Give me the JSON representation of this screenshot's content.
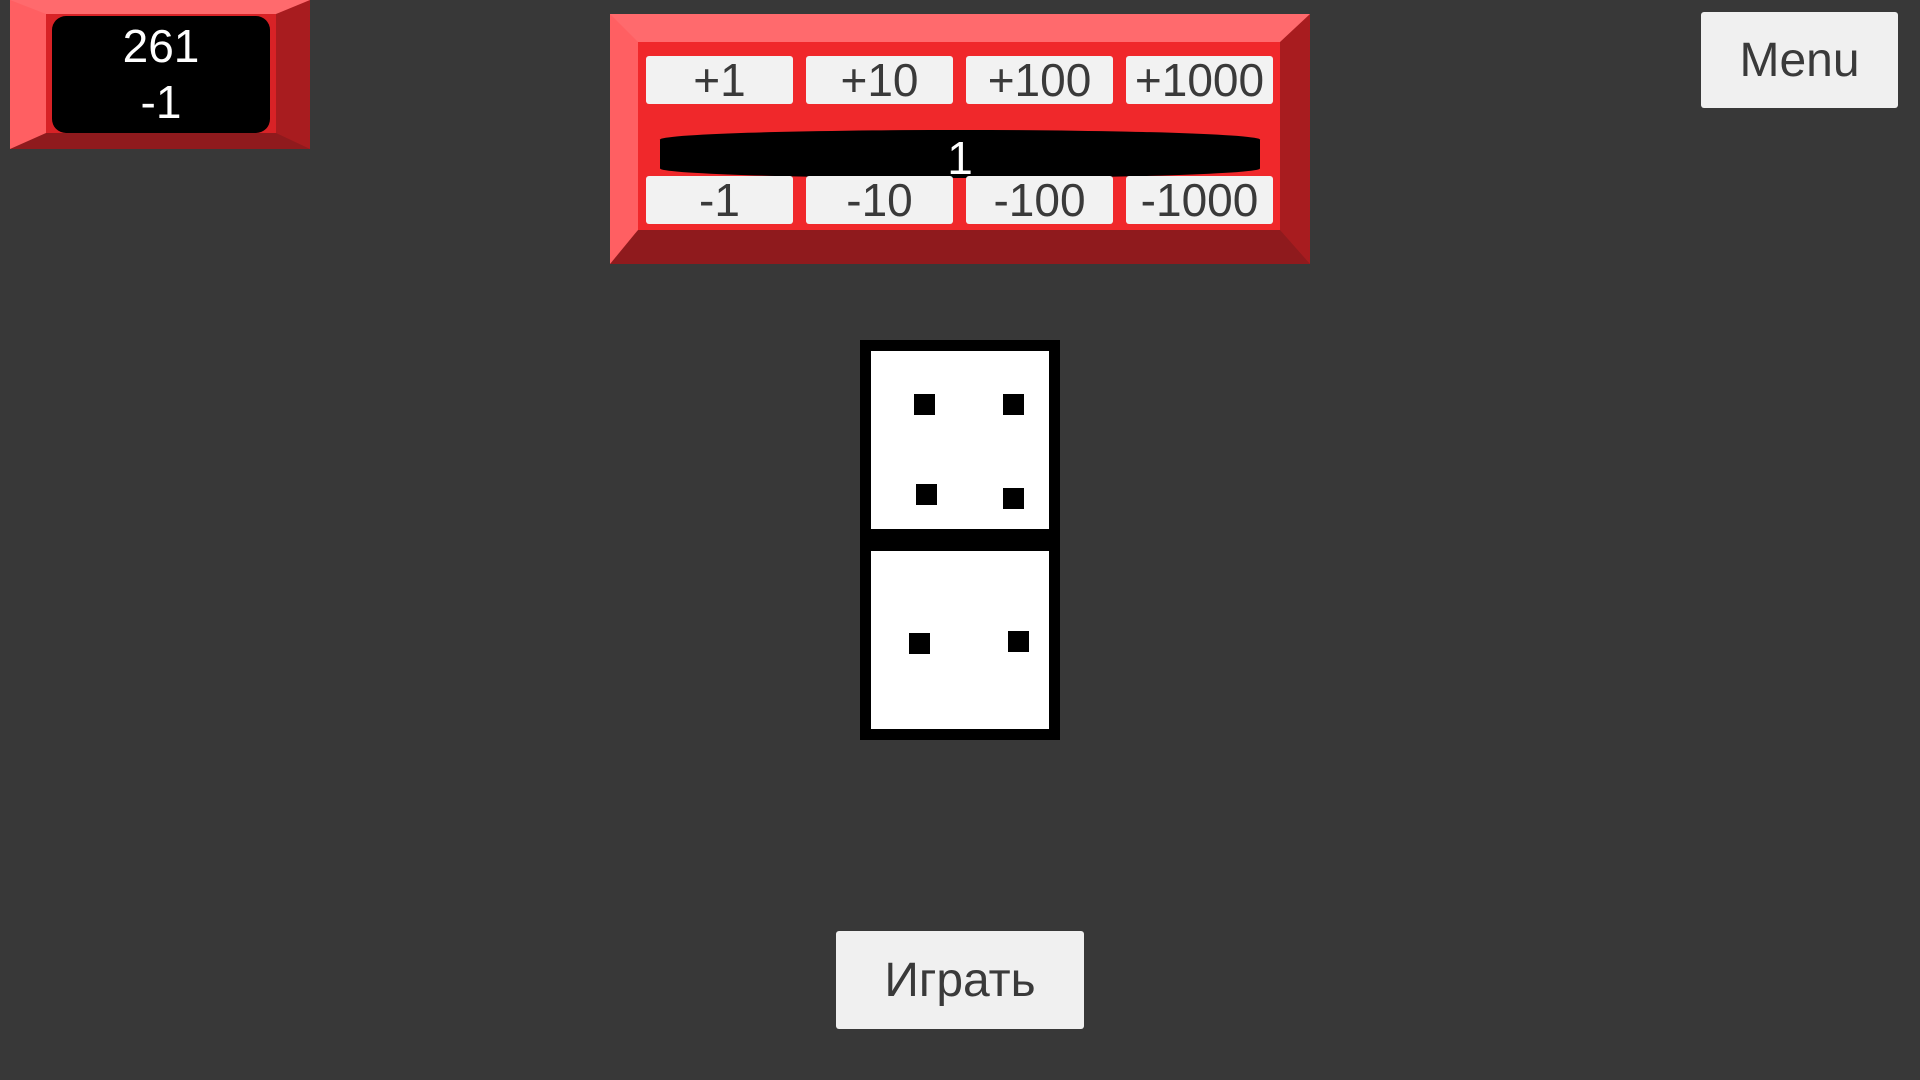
{
  "score_panel": {
    "balance": "261",
    "last_change": "-1"
  },
  "bet_panel": {
    "increment_buttons": [
      "+1",
      "+10",
      "+100",
      "+1000"
    ],
    "bet_value": "1",
    "decrement_buttons": [
      "-1",
      "-10",
      "-100",
      "-1000"
    ]
  },
  "menu": {
    "label": "Menu"
  },
  "domino": {
    "top_pips": 4,
    "bottom_pips": 2
  },
  "play": {
    "label": "Играть"
  },
  "colors": {
    "background": "#383838",
    "panel_red": "#f0282b",
    "button_face": "#f2f2f2",
    "button_text": "#3a3a3a"
  }
}
